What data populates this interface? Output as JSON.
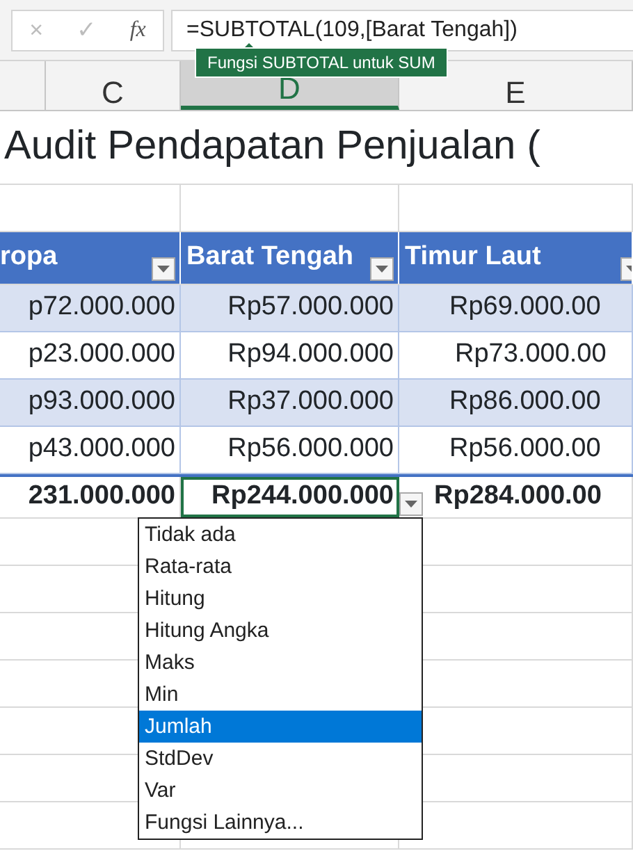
{
  "formula_bar": {
    "cancel": "×",
    "enter": "✓",
    "fx": "fx",
    "formula": "=SUBTOTAL(109,[Barat Tengah])"
  },
  "tooltip": "Fungsi SUBTOTAL untuk SUM",
  "column_headers": [
    {
      "label": "C",
      "selected": false
    },
    {
      "label": "D",
      "selected": true
    },
    {
      "label": "E",
      "selected": false
    }
  ],
  "title": "Audit Pendapatan Penjualan (",
  "table": {
    "columns": [
      "ropa",
      "Barat Tengah",
      "Timur Laut"
    ],
    "rows": [
      [
        "p72.000.000",
        "Rp57.000.000",
        "Rp69.000.00"
      ],
      [
        "p23.000.000",
        "Rp94.000.000",
        "Rp73.000.00"
      ],
      [
        "p93.000.000",
        "Rp37.000.000",
        "Rp86.000.00"
      ],
      [
        "p43.000.000",
        "Rp56.000.000",
        "Rp56.000.00"
      ]
    ],
    "total": [
      "231.000.000",
      "Rp244.000.000",
      "Rp284.000.00"
    ]
  },
  "menu": {
    "items": [
      {
        "label": "Tidak ada",
        "selected": false
      },
      {
        "label": "Rata-rata",
        "selected": false
      },
      {
        "label": "Hitung",
        "selected": false
      },
      {
        "label": "Hitung Angka",
        "selected": false
      },
      {
        "label": "Maks",
        "selected": false
      },
      {
        "label": "Min",
        "selected": false
      },
      {
        "label": "Jumlah",
        "selected": true
      },
      {
        "label": "StdDev",
        "selected": false
      },
      {
        "label": "Var",
        "selected": false
      },
      {
        "label": "Fungsi Lainnya...",
        "selected": false
      }
    ]
  }
}
